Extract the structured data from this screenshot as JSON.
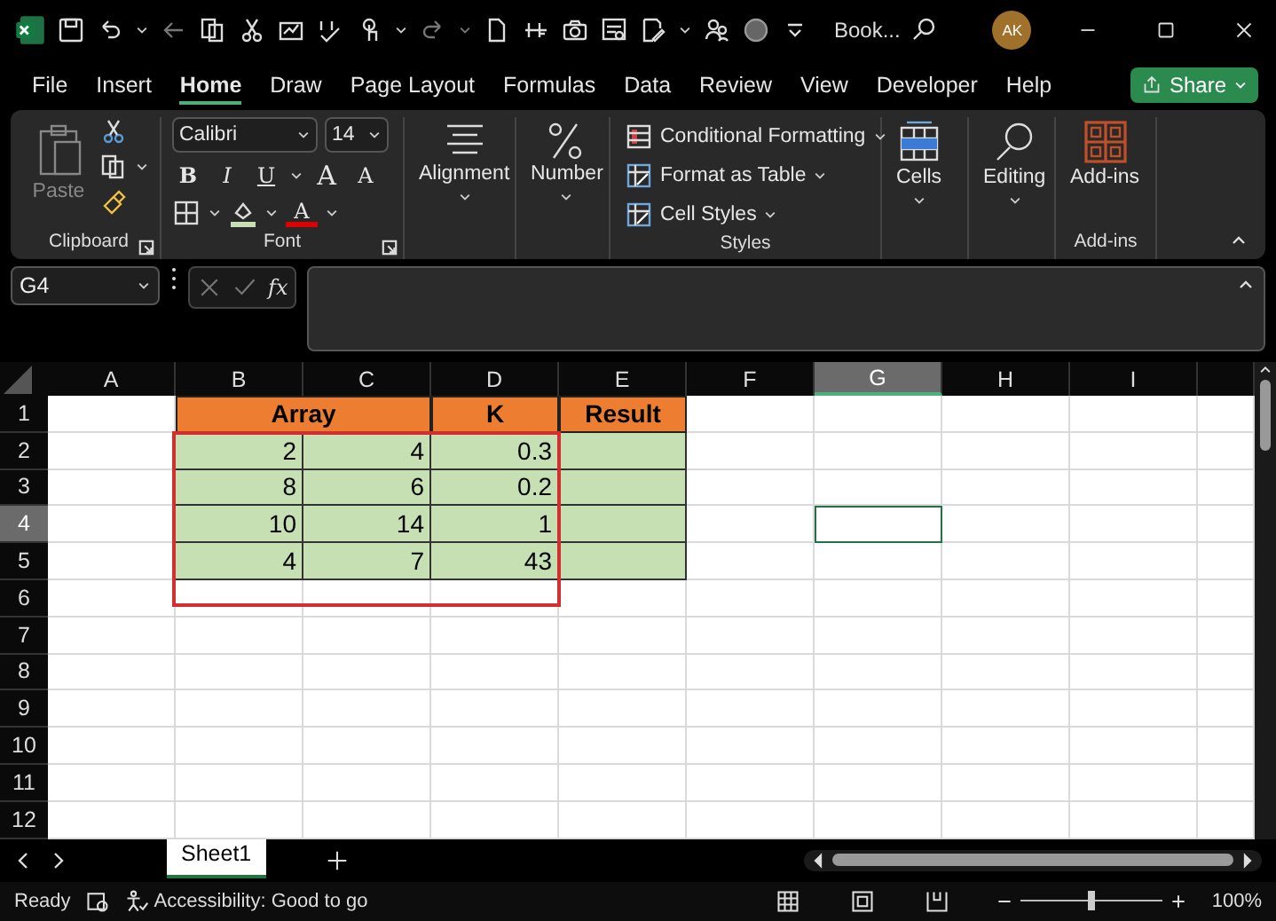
{
  "title_bar": {
    "file_name": "Book...",
    "avatar": "AK"
  },
  "menu_tabs": [
    {
      "label": "File",
      "selected": false
    },
    {
      "label": "Insert",
      "selected": false
    },
    {
      "label": "Home",
      "selected": true
    },
    {
      "label": "Draw",
      "selected": false
    },
    {
      "label": "Page Layout",
      "selected": false
    },
    {
      "label": "Formulas",
      "selected": false
    },
    {
      "label": "Data",
      "selected": false
    },
    {
      "label": "Review",
      "selected": false
    },
    {
      "label": "View",
      "selected": false
    },
    {
      "label": "Developer",
      "selected": false
    },
    {
      "label": "Help",
      "selected": false
    }
  ],
  "share_button": "Share",
  "ribbon": {
    "clipboard": {
      "paste": "Paste",
      "label": "Clipboard"
    },
    "font": {
      "font_name": "Calibri",
      "font_size": "14",
      "format_buttons": [
        "B",
        "I",
        "U"
      ],
      "size_buttons": [
        "A",
        "A"
      ],
      "font_color": "A",
      "label": "Font"
    },
    "alignment": "Alignment",
    "number": "Number",
    "styles": {
      "items": [
        "Conditional Formatting",
        "Format as Table",
        "Cell Styles"
      ],
      "label": "Styles"
    },
    "cells": "Cells",
    "editing": "Editing",
    "addins": {
      "button": "Add-ins",
      "label": "Add-ins"
    }
  },
  "formula_bar": {
    "name_box": "G4",
    "function_label": "fx"
  },
  "sheet": {
    "columns": [
      {
        "label": "A",
        "selected": false
      },
      {
        "label": "B",
        "selected": false
      },
      {
        "label": "C",
        "selected": false
      },
      {
        "label": "D",
        "selected": false
      },
      {
        "label": "E",
        "selected": false
      },
      {
        "label": "F",
        "selected": false
      },
      {
        "label": "G",
        "selected": true
      },
      {
        "label": "H",
        "selected": false
      },
      {
        "label": "I",
        "selected": false
      }
    ],
    "rows": [
      {
        "label": "1",
        "selected": false,
        "cells": [
          {
            "kind": "plain"
          },
          {
            "text": "Array",
            "kind": "header",
            "merged": true
          },
          {
            "kind": "header"
          },
          {
            "text": "K",
            "kind": "header"
          },
          {
            "text": "Result",
            "kind": "header"
          },
          {
            "kind": "plain"
          },
          {
            "kind": "plain"
          },
          {
            "kind": "plain"
          },
          {
            "kind": "plain"
          }
        ]
      },
      {
        "label": "2",
        "selected": false,
        "cells": [
          {
            "kind": "plain"
          },
          {
            "text": "2",
            "kind": "data"
          },
          {
            "text": "4",
            "kind": "data"
          },
          {
            "text": "0.3",
            "kind": "data"
          },
          {
            "kind": "data"
          },
          {
            "kind": "plain"
          },
          {
            "kind": "plain"
          },
          {
            "kind": "plain"
          },
          {
            "kind": "plain"
          }
        ]
      },
      {
        "label": "3",
        "selected": false,
        "cells": [
          {
            "kind": "plain"
          },
          {
            "text": "8",
            "kind": "data"
          },
          {
            "text": "6",
            "kind": "data"
          },
          {
            "text": "0.2",
            "kind": "data"
          },
          {
            "kind": "data"
          },
          {
            "kind": "plain"
          },
          {
            "kind": "plain"
          },
          {
            "kind": "plain"
          },
          {
            "kind": "plain"
          }
        ]
      },
      {
        "label": "4",
        "selected": true,
        "cells": [
          {
            "kind": "plain"
          },
          {
            "text": "10",
            "kind": "data"
          },
          {
            "text": "14",
            "kind": "data"
          },
          {
            "text": "1",
            "kind": "data"
          },
          {
            "kind": "data"
          },
          {
            "kind": "plain"
          },
          {
            "kind": "plain"
          },
          {
            "kind": "plain"
          },
          {
            "kind": "plain"
          }
        ]
      },
      {
        "label": "5",
        "selected": false,
        "cells": [
          {
            "kind": "plain"
          },
          {
            "text": "4",
            "kind": "data"
          },
          {
            "text": "7",
            "kind": "data"
          },
          {
            "text": "43",
            "kind": "data"
          },
          {
            "kind": "data"
          },
          {
            "kind": "plain"
          },
          {
            "kind": "plain"
          },
          {
            "kind": "plain"
          },
          {
            "kind": "plain"
          }
        ]
      },
      {
        "label": "6",
        "selected": false,
        "cells": [
          {
            "kind": "plain"
          },
          {
            "kind": "plain"
          },
          {
            "kind": "plain"
          },
          {
            "kind": "plain"
          },
          {
            "kind": "plain"
          },
          {
            "kind": "plain"
          },
          {
            "kind": "plain"
          },
          {
            "kind": "plain"
          },
          {
            "kind": "plain"
          }
        ]
      },
      {
        "label": "7",
        "selected": false,
        "cells": [
          {
            "kind": "plain"
          },
          {
            "kind": "plain"
          },
          {
            "kind": "plain"
          },
          {
            "kind": "plain"
          },
          {
            "kind": "plain"
          },
          {
            "kind": "plain"
          },
          {
            "kind": "plain"
          },
          {
            "kind": "plain"
          },
          {
            "kind": "plain"
          }
        ]
      },
      {
        "label": "8",
        "selected": false,
        "cells": [
          {
            "kind": "plain"
          },
          {
            "kind": "plain"
          },
          {
            "kind": "plain"
          },
          {
            "kind": "plain"
          },
          {
            "kind": "plain"
          },
          {
            "kind": "plain"
          },
          {
            "kind": "plain"
          },
          {
            "kind": "plain"
          },
          {
            "kind": "plain"
          }
        ]
      },
      {
        "label": "9",
        "selected": false,
        "cells": [
          {
            "kind": "plain"
          },
          {
            "kind": "plain"
          },
          {
            "kind": "plain"
          },
          {
            "kind": "plain"
          },
          {
            "kind": "plain"
          },
          {
            "kind": "plain"
          },
          {
            "kind": "plain"
          },
          {
            "kind": "plain"
          },
          {
            "kind": "plain"
          }
        ]
      },
      {
        "label": "10",
        "selected": false,
        "cells": [
          {
            "kind": "plain"
          },
          {
            "kind": "plain"
          },
          {
            "kind": "plain"
          },
          {
            "kind": "plain"
          },
          {
            "kind": "plain"
          },
          {
            "kind": "plain"
          },
          {
            "kind": "plain"
          },
          {
            "kind": "plain"
          },
          {
            "kind": "plain"
          }
        ]
      },
      {
        "label": "11",
        "selected": false,
        "cells": [
          {
            "kind": "plain"
          },
          {
            "kind": "plain"
          },
          {
            "kind": "plain"
          },
          {
            "kind": "plain"
          },
          {
            "kind": "plain"
          },
          {
            "kind": "plain"
          },
          {
            "kind": "plain"
          },
          {
            "kind": "plain"
          },
          {
            "kind": "plain"
          }
        ]
      },
      {
        "label": "12",
        "selected": false,
        "cells": [
          {
            "kind": "plain"
          },
          {
            "kind": "plain"
          },
          {
            "kind": "plain"
          },
          {
            "kind": "plain"
          },
          {
            "kind": "plain"
          },
          {
            "kind": "plain"
          },
          {
            "kind": "plain"
          },
          {
            "kind": "plain"
          },
          {
            "kind": "plain"
          }
        ]
      }
    ]
  },
  "sheet_tabs": [
    {
      "label": "Sheet1",
      "selected": true
    }
  ],
  "status_bar": {
    "status": "Ready",
    "accessibility": "Accessibility: Good to go",
    "zoom": "100%",
    "zoom_level": {
      "level": 0.5
    }
  }
}
